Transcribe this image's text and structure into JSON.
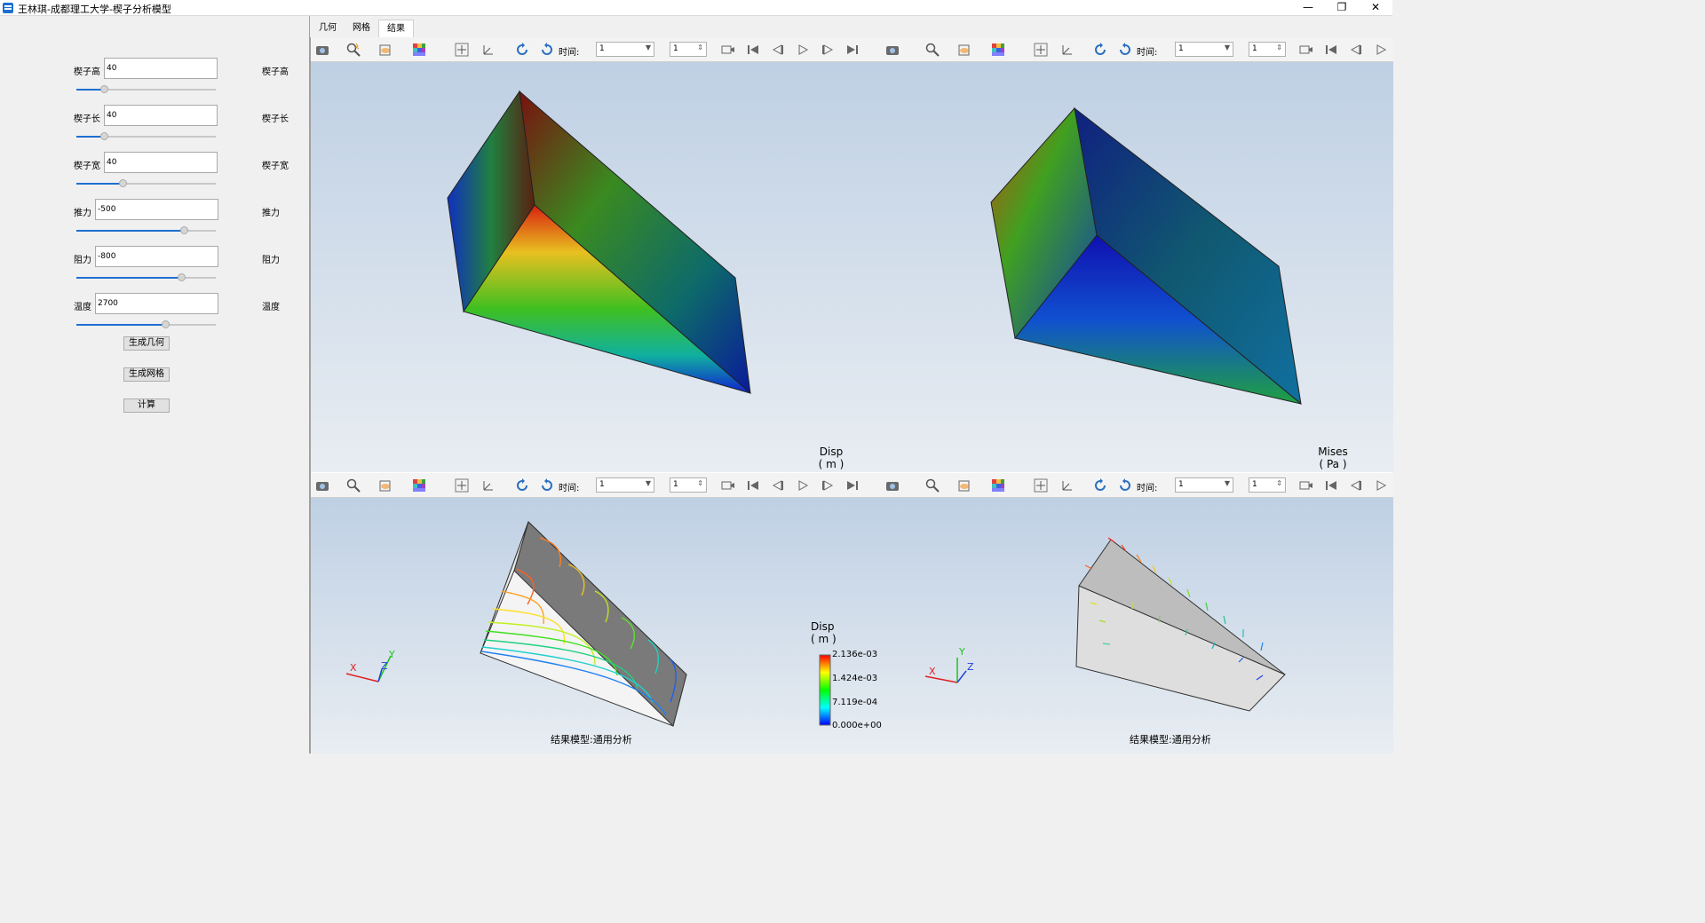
{
  "window": {
    "title": "王林琪-成都理工大学-楔子分析模型",
    "minimize": "—",
    "maximize": "❐",
    "close": "✕"
  },
  "params": [
    {
      "label": "楔子高",
      "value": "40",
      "label_right": "楔子高",
      "slider_fraction": 0.2
    },
    {
      "label": "楔子长",
      "value": "40",
      "label_right": "楔子长",
      "slider_fraction": 0.2
    },
    {
      "label": "楔子宽",
      "value": "40",
      "label_right": "楔子宽",
      "slider_fraction": 0.33
    },
    {
      "label": "推力",
      "value": "-500",
      "label_right": "推力",
      "slider_fraction": 0.77
    },
    {
      "label": "阻力",
      "value": "-800",
      "label_right": "阻力",
      "slider_fraction": 0.75
    },
    {
      "label": "温度",
      "value": "2700",
      "label_right": "温度",
      "slider_fraction": 0.64
    }
  ],
  "buttons": {
    "gen_geometry": "生成几何",
    "gen_mesh": "生成网格",
    "compute": "计算"
  },
  "tabs": [
    "几何",
    "网格",
    "结果"
  ],
  "active_tab": "结果",
  "toolbar": {
    "time_label": "时间:",
    "time_value": "1",
    "step_value": "1"
  },
  "views": {
    "top_left_legend_title": "Disp",
    "top_left_legend_unit": "( m )",
    "top_right_legend_title": "Mises",
    "top_right_legend_unit": "( Pa )",
    "bottom_legend_title": "Disp",
    "bottom_legend_unit": "( m )",
    "bottom_legend_ticks": [
      "2.136e-03",
      "1.424e-03",
      "7.119e-04",
      "0.000e+00"
    ],
    "bottom_left_caption": "结果模型:通用分析",
    "bottom_right_caption": "结果模型:通用分析",
    "axis_x": "X",
    "axis_y": "Y",
    "axis_z": "Z"
  },
  "colors": {
    "accent": "#1e6fd0",
    "viewport_top": "#bfd0e4",
    "viewport_bottom": "#e8edf2"
  }
}
